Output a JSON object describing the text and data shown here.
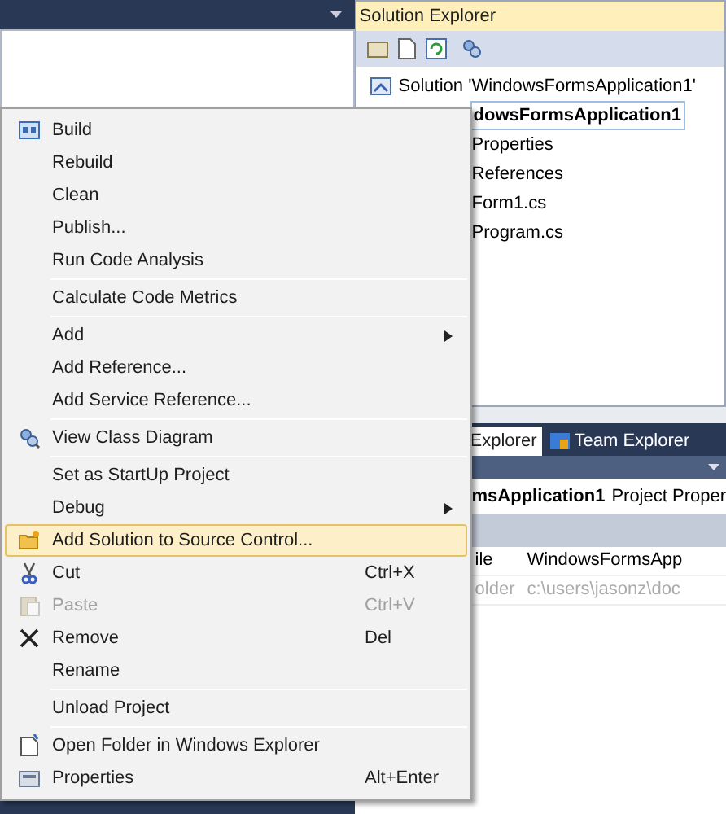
{
  "solution_explorer": {
    "title": "Solution Explorer",
    "tree": [
      {
        "label": "Solution 'WindowsFormsApplication1'",
        "bold": false,
        "children": [
          {
            "label": "dowsFormsApplication1",
            "bold": true,
            "children": [
              {
                "label": "Properties",
                "bold": false
              },
              {
                "label": "References",
                "bold": false
              },
              {
                "label": "Form1.cs",
                "bold": false
              },
              {
                "label": "Program.cs",
                "bold": false
              }
            ]
          }
        ]
      }
    ]
  },
  "bottom_tabs": [
    {
      "label": "Explorer",
      "selected": true
    },
    {
      "label": "Team Explorer",
      "selected": false
    }
  ],
  "properties": {
    "object": "msApplication1",
    "type": "Project Proper",
    "rows": [
      {
        "name": "ile",
        "value": "WindowsFormsApp",
        "disabled": false
      },
      {
        "name": "older",
        "value": "c:\\users\\jasonz\\doc",
        "disabled": true
      }
    ]
  },
  "context_menu": [
    {
      "kind": "item",
      "label": "Build",
      "disabled": false,
      "selected": false,
      "submenu": false
    },
    {
      "kind": "item",
      "label": "Rebuild",
      "disabled": false,
      "selected": false,
      "submenu": false
    },
    {
      "kind": "item",
      "label": "Clean",
      "disabled": false,
      "selected": false,
      "submenu": false
    },
    {
      "kind": "item",
      "label": "Publish...",
      "disabled": false,
      "selected": false,
      "submenu": false
    },
    {
      "kind": "item",
      "label": "Run Code Analysis",
      "disabled": false,
      "selected": false,
      "submenu": false
    },
    {
      "kind": "separator"
    },
    {
      "kind": "item",
      "label": "Calculate Code Metrics",
      "disabled": false,
      "selected": false,
      "submenu": false
    },
    {
      "kind": "separator"
    },
    {
      "kind": "item",
      "label": "Add",
      "disabled": false,
      "selected": false,
      "submenu": true
    },
    {
      "kind": "item",
      "label": "Add Reference...",
      "disabled": false,
      "selected": false,
      "submenu": false
    },
    {
      "kind": "item",
      "label": "Add Service Reference...",
      "disabled": false,
      "selected": false,
      "submenu": false
    },
    {
      "kind": "separator"
    },
    {
      "kind": "item",
      "label": "View Class Diagram",
      "disabled": false,
      "selected": false,
      "submenu": false
    },
    {
      "kind": "separator"
    },
    {
      "kind": "item",
      "label": "Set as StartUp Project",
      "disabled": false,
      "selected": false,
      "submenu": false
    },
    {
      "kind": "item",
      "label": "Debug",
      "disabled": false,
      "selected": false,
      "submenu": true
    },
    {
      "kind": "item",
      "label": "Add Solution to Source Control...",
      "disabled": false,
      "selected": true,
      "submenu": false
    },
    {
      "kind": "item",
      "label": "Cut",
      "shortcut": "Ctrl+X",
      "disabled": false,
      "selected": false,
      "submenu": false
    },
    {
      "kind": "item",
      "label": "Paste",
      "shortcut": "Ctrl+V",
      "disabled": true,
      "selected": false,
      "submenu": false
    },
    {
      "kind": "item",
      "label": "Remove",
      "shortcut": "Del",
      "disabled": false,
      "selected": false,
      "submenu": false
    },
    {
      "kind": "item",
      "label": "Rename",
      "disabled": false,
      "selected": false,
      "submenu": false
    },
    {
      "kind": "separator"
    },
    {
      "kind": "item",
      "label": "Unload Project",
      "disabled": false,
      "selected": false,
      "submenu": false
    },
    {
      "kind": "separator"
    },
    {
      "kind": "item",
      "label": "Open Folder in Windows Explorer",
      "disabled": false,
      "selected": false,
      "submenu": false
    },
    {
      "kind": "item",
      "label": "Properties",
      "shortcut": "Alt+Enter",
      "disabled": false,
      "selected": false,
      "submenu": false
    }
  ]
}
